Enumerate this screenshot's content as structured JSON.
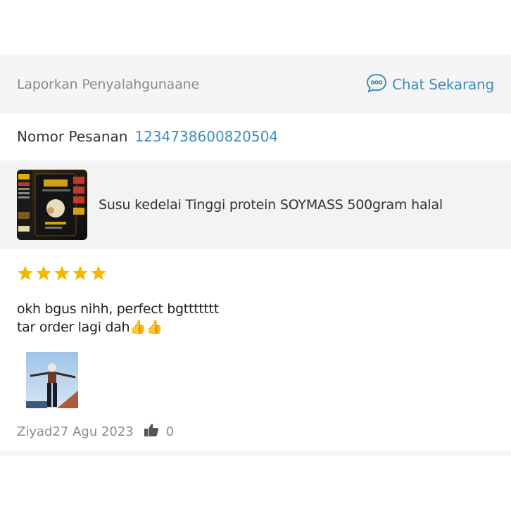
{
  "report": {
    "label": "Laporkan Penyalahgunaane"
  },
  "chat": {
    "label": "Chat Sekarang",
    "icon": "chat-bubble-icon",
    "color": "#3c8dbc"
  },
  "order": {
    "label": "Nomor Pesanan",
    "number": "1234738600820504"
  },
  "product": {
    "name": "Susu kedelai Tinggi protein SOYMASS 500gram halal",
    "thumbnail": "soymass-product-image"
  },
  "review": {
    "rating": 5,
    "rating_max": 5,
    "star_color": "#f5b800",
    "line1": "okh bgus nihh, perfect bgttttttt",
    "line2": "tar order lagi dah",
    "emoji": "👍👍",
    "author": "Ziyad",
    "date": "27 Agu 2023",
    "likes": "0"
  }
}
